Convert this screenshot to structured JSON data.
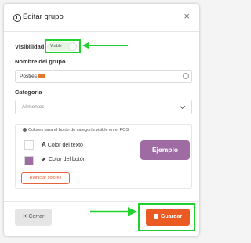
{
  "dialog": {
    "title": "Editar grupo",
    "close_glyph": "×"
  },
  "visibility": {
    "label": "Visibilidad",
    "toggle_text": "Visible",
    "checked": true
  },
  "group_name": {
    "label": "Nombre del grupo",
    "value": "Postres",
    "emoji_icon": "cake-icon"
  },
  "category": {
    "label": "Categoria",
    "selected": "Alimentos"
  },
  "colors": {
    "info": "Colores para el botón de categoría visible en el POS",
    "text_color_label": "Color del texto",
    "button_color_label": "Color del botón",
    "text_color": "#ffffff",
    "button_color": "#9e6ca3",
    "preview_label": "Ejemplo",
    "reset_label": "Reiniciar colores"
  },
  "footer": {
    "cancel_label": "Cerrar",
    "save_label": "Guardar"
  },
  "highlight_color": "#23d12e",
  "accent_color": "#ea5a23"
}
